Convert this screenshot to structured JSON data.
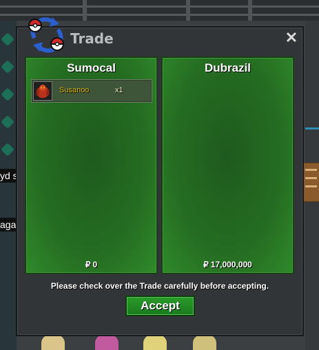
{
  "background": {
    "player_tags": [
      "yd s",
      "aga"
    ]
  },
  "window": {
    "title": "Trade",
    "logo_icon": "trade-swap-pokeball-icon",
    "close_label": "✕"
  },
  "left_panel": {
    "trader_name": "Sumocal",
    "items": [
      {
        "name": "Susanoo",
        "quantity": "x1",
        "icon": "susanoo-sprite-icon"
      }
    ],
    "currency_symbol": "₽",
    "money": "0"
  },
  "right_panel": {
    "trader_name": "Dubrazil",
    "items": [],
    "currency_symbol": "₽",
    "money": "17,000,000"
  },
  "notice": "Please check over the Trade carefully before accepting.",
  "accept_label": "Accept",
  "colors": {
    "panel_green": "#256d22",
    "item_name": "#d9b40c",
    "accept_button": "#2a9a2a",
    "window_bg": "#323538"
  }
}
